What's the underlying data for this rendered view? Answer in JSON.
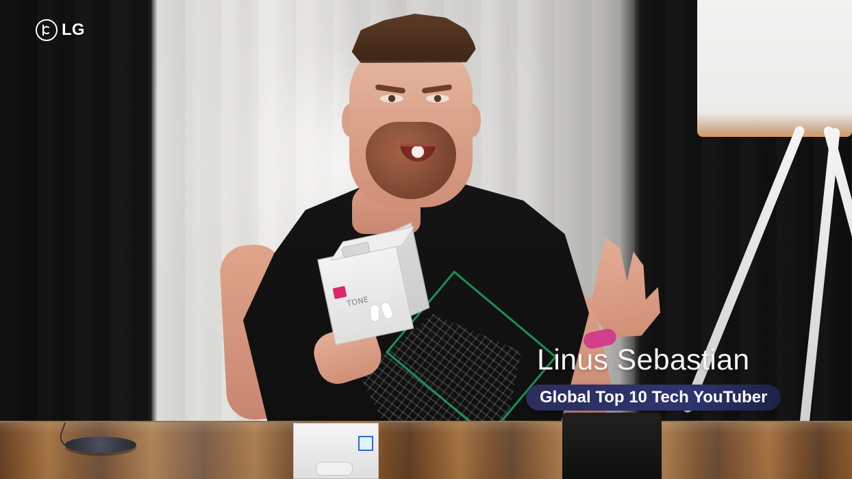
{
  "brand": {
    "logo_text": "LG"
  },
  "lower_third": {
    "name": "Linus Sebastian",
    "subtitle": "Global Top 10 Tech YouTuber"
  },
  "product": {
    "box_label": "TONE"
  },
  "colors": {
    "subtitle_bg_start": "#2c2d5c",
    "subtitle_bg_end": "#1d2144",
    "name_text": "#f4f4f4",
    "logo_text": "#ffffff"
  }
}
